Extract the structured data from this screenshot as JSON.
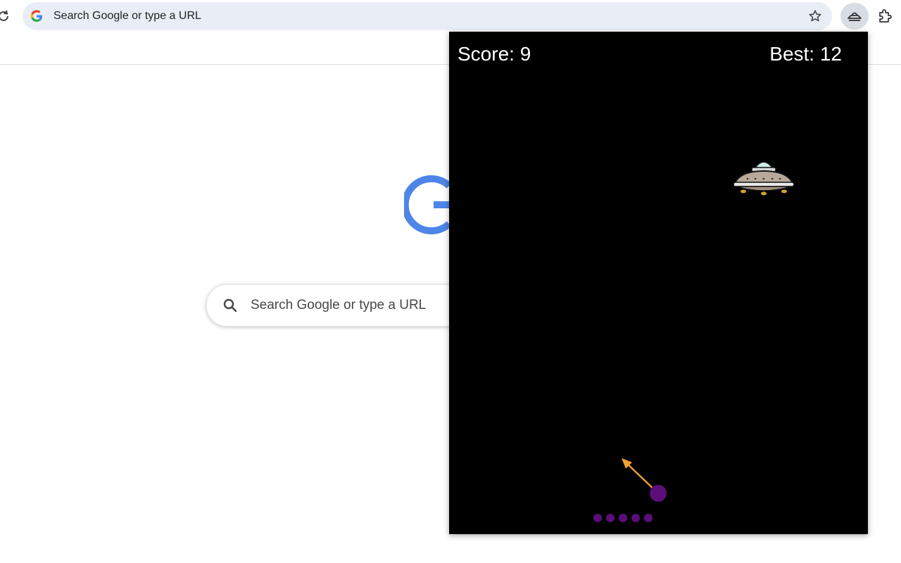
{
  "browser": {
    "omnibox_text": "Search Google or type a URL"
  },
  "ntp": {
    "search_placeholder": "Search Google or type a URL"
  },
  "game": {
    "score_text": "Score: 9",
    "best_text": "Best: 12",
    "score": 9,
    "best": 12,
    "remaining_shots": 5,
    "colors": {
      "background": "#000000",
      "ball": "#5b0e7a",
      "aim_arrow": "#f0a030",
      "text": "#ffffff"
    },
    "icons": {
      "enemy": "ufo-icon",
      "player": "ball-launcher"
    }
  }
}
